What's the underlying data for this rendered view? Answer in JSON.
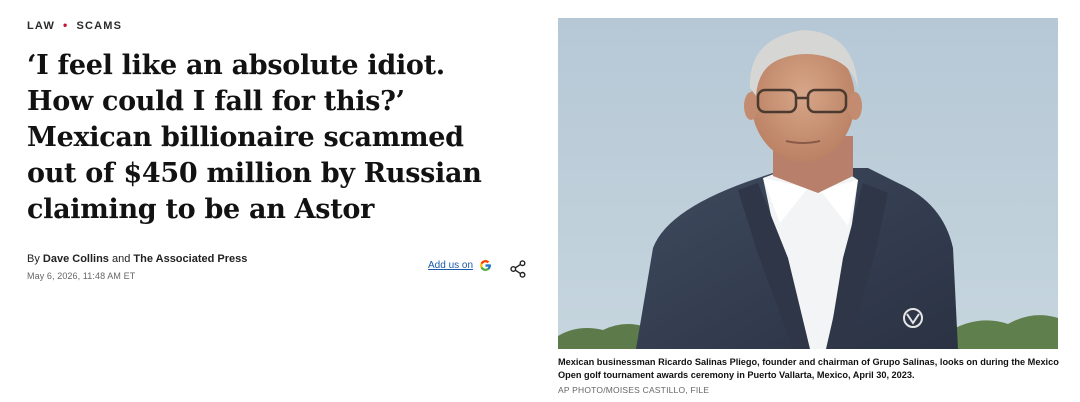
{
  "kicker": {
    "cat1": "LAW",
    "separator": "•",
    "cat2": "SCAMS"
  },
  "headline": "‘I feel like an absolute idiot. How could I fall for this?’ Mexican billionaire scammed out of $450 million by Russian claiming to be an Astor",
  "byline": {
    "prefix": "By",
    "author1": "Dave Collins",
    "joiner": "and",
    "author2": "The Associated Press"
  },
  "dateline": "May 6, 2026, 11:48 AM ET",
  "actions": {
    "add_us_label": "Add us on",
    "google_icon": "google-icon",
    "share_icon": "share-icon"
  },
  "photo": {
    "caption": "Mexican businessman Ricardo Salinas Pliego, founder and chairman of Grupo Salinas, looks on during the Mexico Open golf tournament awards ceremony in Puerto Vallarta, Mexico, April 30, 2023.",
    "credit": "AP PHOTO/MOISES CASTILLO, FILE"
  }
}
